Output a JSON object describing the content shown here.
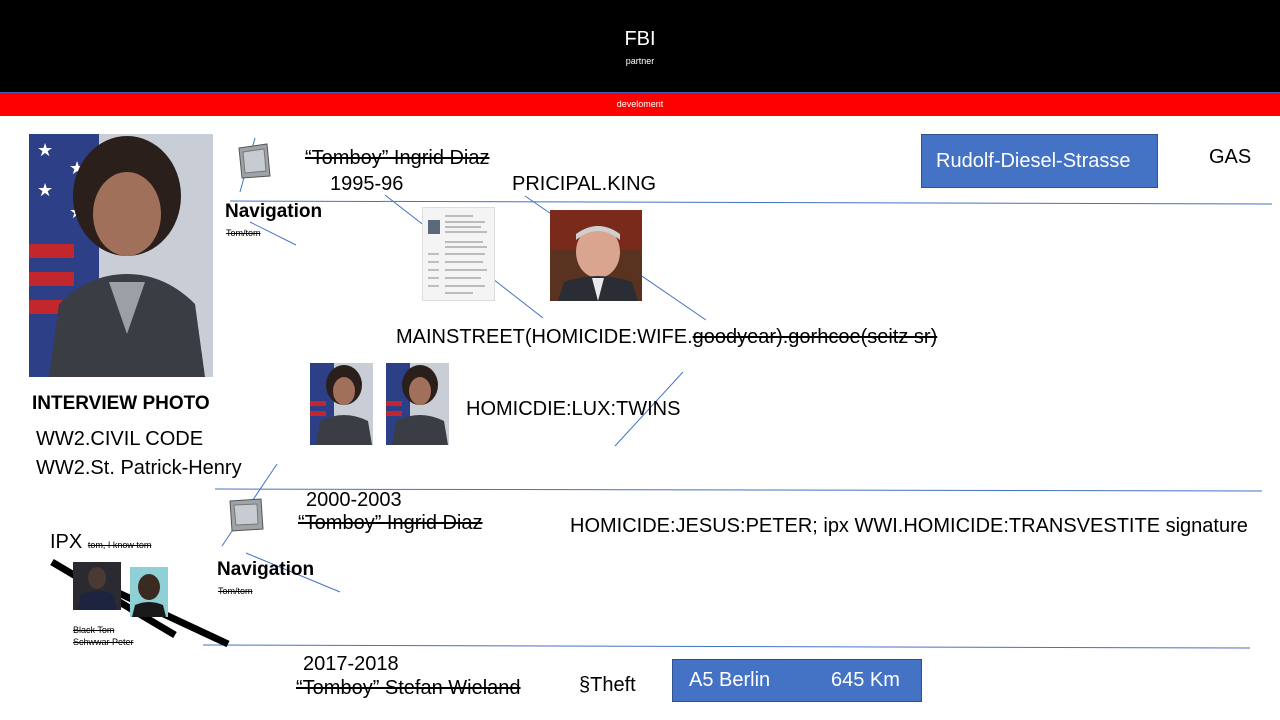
{
  "header": {
    "title": "FBI",
    "subtitle": "partner"
  },
  "red_bar": {
    "label": "develoment"
  },
  "block1": {
    "name": "“Tomboy” Ingrid Diaz",
    "years": "1995-96",
    "principal": "PRICIPAL.KING",
    "nav_label": "Navigation",
    "nav_sub": "Tom/tom",
    "street_box": "Rudolf-Diesel-Strasse",
    "gas": "GAS",
    "mainstreet_plain": "MAINSTREET(HOMICIDE:WIFE.",
    "mainstreet_struck": "goodyear).gorhcoe(seitz sr)",
    "twins": "HOMICDIE:LUX:TWINS"
  },
  "left": {
    "photo_caption": "INTERVIEW PHOTO",
    "line1": "WW2.CIVIL CODE",
    "line2": "WW2.St. Patrick-Henry"
  },
  "block2": {
    "years": "2000-2003",
    "name": "“Tomboy” Ingrid Diaz",
    "homicide": "HOMICIDE:JESUS:PETER; ipx WWI.HOMICIDE:TRANSVESTITE  signature",
    "nav_label": "Navigation",
    "nav_sub": "Tom/tom",
    "ipx": "IPX",
    "ipx_note": "tom, I know tom",
    "cap1": "Black Tom",
    "cap2": "Schwwar Peter"
  },
  "block3": {
    "years": "2017-2018",
    "name": "“Tomboy” Stefan Wieland",
    "theft": "§Theft",
    "route_road": "A5  Berlin",
    "route_km": "645 Km"
  },
  "colors": {
    "header_bg": "#000000",
    "red_bar": "#ff0000",
    "box_blue": "#4472c4",
    "line_blue": "#4472c4"
  }
}
